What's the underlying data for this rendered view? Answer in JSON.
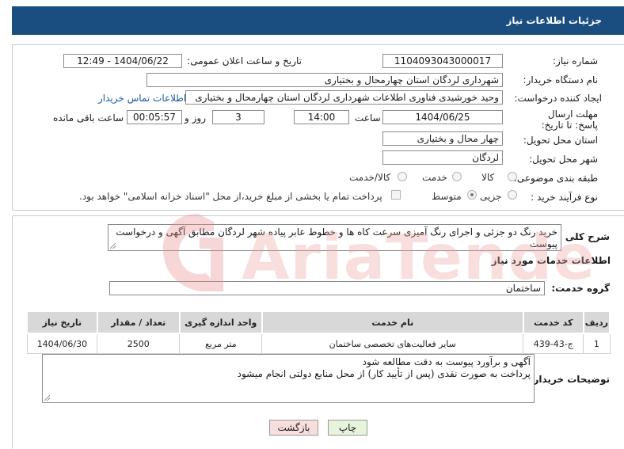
{
  "header": {
    "title": "جزئیات اطلاعات نیاز"
  },
  "form": {
    "need_number": {
      "label": "شماره نیاز:",
      "value": "1104093043000017"
    },
    "announce_datetime": {
      "label": "تاریخ و ساعت اعلان عمومی:",
      "value": "1404/06/22 - 12:49"
    },
    "buyer_org": {
      "label": "نام دستگاه خریدار:",
      "value": "شهرداری لردگان استان چهارمحال و بختیاری"
    },
    "requester": {
      "label": "ایجاد کننده درخواست:",
      "value": "وحید خورشیدی فناوری اطلاعات شهرداری لردگان استان چهارمحال و بختیاری",
      "contact_link": "اطلاعات تماس خریدار"
    },
    "deadline": {
      "label": "مهلت ارسال پاسخ: تا تاریخ:",
      "date": "1404/06/25",
      "time_label": "ساعت",
      "time": "14:00",
      "days": "3",
      "days_label": "روز و",
      "remaining": "00:05:57",
      "remaining_label": "ساعت باقی مانده"
    },
    "province": {
      "label": "استان محل تحویل:",
      "value": "چهار محال و بختیاری"
    },
    "city": {
      "label": "شهر محل تحویل:",
      "value": "لردگان"
    },
    "category": {
      "label": "طبقه بندی موضوعی:",
      "options": [
        "کالا",
        "خدمت",
        "کالا/خدمت"
      ]
    },
    "process": {
      "label": "نوع فرآیند خرید :",
      "options": [
        "جزیی",
        "متوسط"
      ],
      "note": "پرداخت تمام یا بخشی از مبلغ خرید،از محل \"اسناد خزانه اسلامی\" خواهد بود."
    }
  },
  "summary": {
    "label": "شرح کلی نیاز:",
    "text": "خرید رنگ دو جزئی و اجرای رنگ آمیزی سرعت کاه ها و خطوط عابر پیاده شهر لردگان مطابق آگهی و درخواست پیوست"
  },
  "services": {
    "section_title": "اطلاعات خدمات مورد نیاز",
    "group_label": "گروه خدمت:",
    "group_value": "ساختمان",
    "columns": [
      "ردیف",
      "کد خدمت",
      "نام خدمت",
      "واحد اندازه گیری",
      "تعداد / مقدار",
      "تاریخ نیاز"
    ],
    "rows": [
      [
        "1",
        "ج-43-439",
        "سایر فعالیت‌های تخصصی ساختمان",
        "متر مربع",
        "2500",
        "1404/06/30"
      ]
    ]
  },
  "buyer_notes": {
    "label": "توضیحات خریدار:",
    "lines": [
      "آگهی و برآورد پیوست به دقت مطالعه شود",
      "پرداخت به صورت نقدی (پس از تأیید کار) از محل منابع دولتی انجام میشود"
    ]
  },
  "buttons": {
    "print": "چاپ",
    "back": "بازگشت"
  },
  "watermark_text": "AriaTender.neT",
  "colors": {
    "header": "#1b4e80",
    "link": "#1c5aa8",
    "print_btn": "#e6f4dc",
    "back_btn": "#f9dede",
    "watermark": "#f3b6b6"
  }
}
